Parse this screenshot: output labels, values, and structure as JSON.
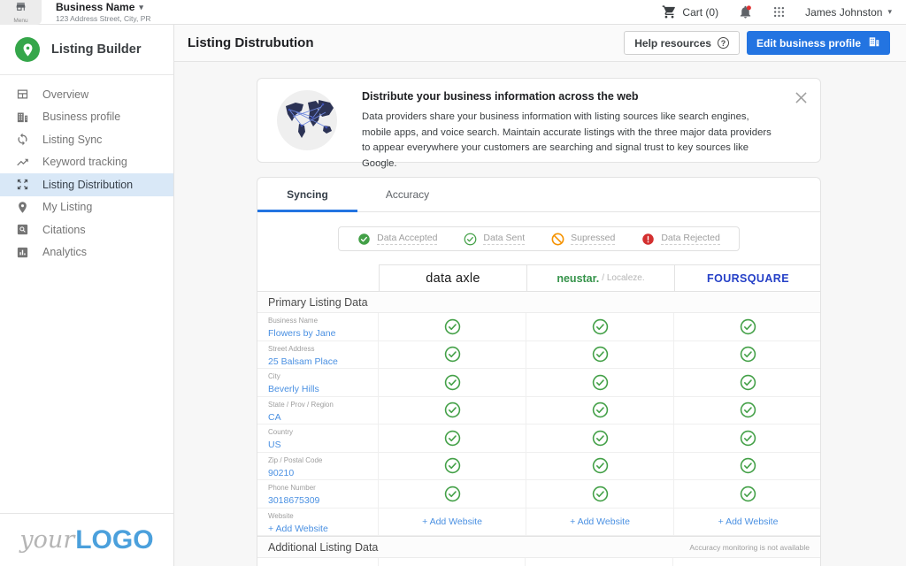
{
  "topbar": {
    "menu_label": "Menu",
    "business_name": "Business Name",
    "business_address": "123 Address Street, City, PR",
    "cart_label": "Cart (0)",
    "user_name": "James Johnston"
  },
  "sidebar": {
    "app_title": "Listing Builder",
    "items": [
      {
        "label": "Overview",
        "icon": "overview-icon",
        "active": false
      },
      {
        "label": "Business profile",
        "icon": "business-profile-icon",
        "active": false
      },
      {
        "label": "Listing Sync",
        "icon": "listing-sync-icon",
        "active": false
      },
      {
        "label": "Keyword tracking",
        "icon": "keyword-tracking-icon",
        "active": false
      },
      {
        "label": "Listing Distribution",
        "icon": "listing-distribution-icon",
        "active": true
      },
      {
        "label": "My Listing",
        "icon": "my-listing-icon",
        "active": false
      },
      {
        "label": "Citations",
        "icon": "citations-icon",
        "active": false
      },
      {
        "label": "Analytics",
        "icon": "analytics-icon",
        "active": false
      }
    ],
    "logo": {
      "prefix": "your",
      "suffix": "LOGO"
    }
  },
  "header": {
    "title": "Listing Distrubution",
    "help_button": "Help resources",
    "edit_button": "Edit business profile"
  },
  "banner": {
    "icon": "world-map-icon",
    "title": "Distribute your business information across the web",
    "body": "Data providers share your business information with listing sources like search engines, mobile apps, and voice search. Maintain accurate listings with the three major data providers to appear everywhere your customers are searching and signal trust to key sources like Google."
  },
  "tabs": [
    {
      "label": "Syncing",
      "active": true
    },
    {
      "label": "Accuracy",
      "active": false
    }
  ],
  "legend": [
    {
      "label": "Data Accepted",
      "status": "accepted"
    },
    {
      "label": "Data Sent",
      "status": "sent"
    },
    {
      "label": "Supressed",
      "status": "supressed"
    },
    {
      "label": "Data Rejected",
      "status": "rejected"
    }
  ],
  "providers": [
    {
      "id": "data-axle",
      "text": "data axle"
    },
    {
      "id": "neustar",
      "text": "neustar.",
      "suffix": "/ Localeze."
    },
    {
      "id": "foursquare",
      "text": "FOURSQUARE"
    }
  ],
  "table": {
    "add_label": "+ Add Website",
    "sections": [
      {
        "title": "Primary Listing Data",
        "note": "",
        "rows": [
          {
            "label": "Business Name",
            "value": "Flowers by Jane",
            "cells": [
              "sent",
              "sent",
              "sent"
            ]
          },
          {
            "label": "Street Address",
            "value": "25 Balsam Place",
            "cells": [
              "sent",
              "sent",
              "sent"
            ]
          },
          {
            "label": "City",
            "value": "Beverly Hills",
            "cells": [
              "sent",
              "sent",
              "sent"
            ]
          },
          {
            "label": "State / Prov / Region",
            "value": "CA",
            "cells": [
              "sent",
              "sent",
              "sent"
            ]
          },
          {
            "label": "Country",
            "value": "US",
            "cells": [
              "sent",
              "sent",
              "sent"
            ]
          },
          {
            "label": "Zip / Postal Code",
            "value": "90210",
            "cells": [
              "sent",
              "sent",
              "sent"
            ]
          },
          {
            "label": "Phone Number",
            "value": "3018675309",
            "cells": [
              "sent",
              "sent",
              "sent"
            ]
          },
          {
            "label": "Website",
            "value": "+ Add Website",
            "cells": [
              "add",
              "add",
              "add"
            ]
          }
        ]
      },
      {
        "title": "Additional Listing Data",
        "note": "Accuracy monitoring is not available",
        "rows": []
      }
    ]
  },
  "colors": {
    "accent_blue": "#2374e1",
    "link_blue": "#4a90e2",
    "status_green": "#43a047",
    "status_orange": "#f59300",
    "status_red": "#d32f2f",
    "neustar_green": "#35934a",
    "foursquare_blue": "#2540c7",
    "active_item_bg": "#d9e8f7"
  }
}
